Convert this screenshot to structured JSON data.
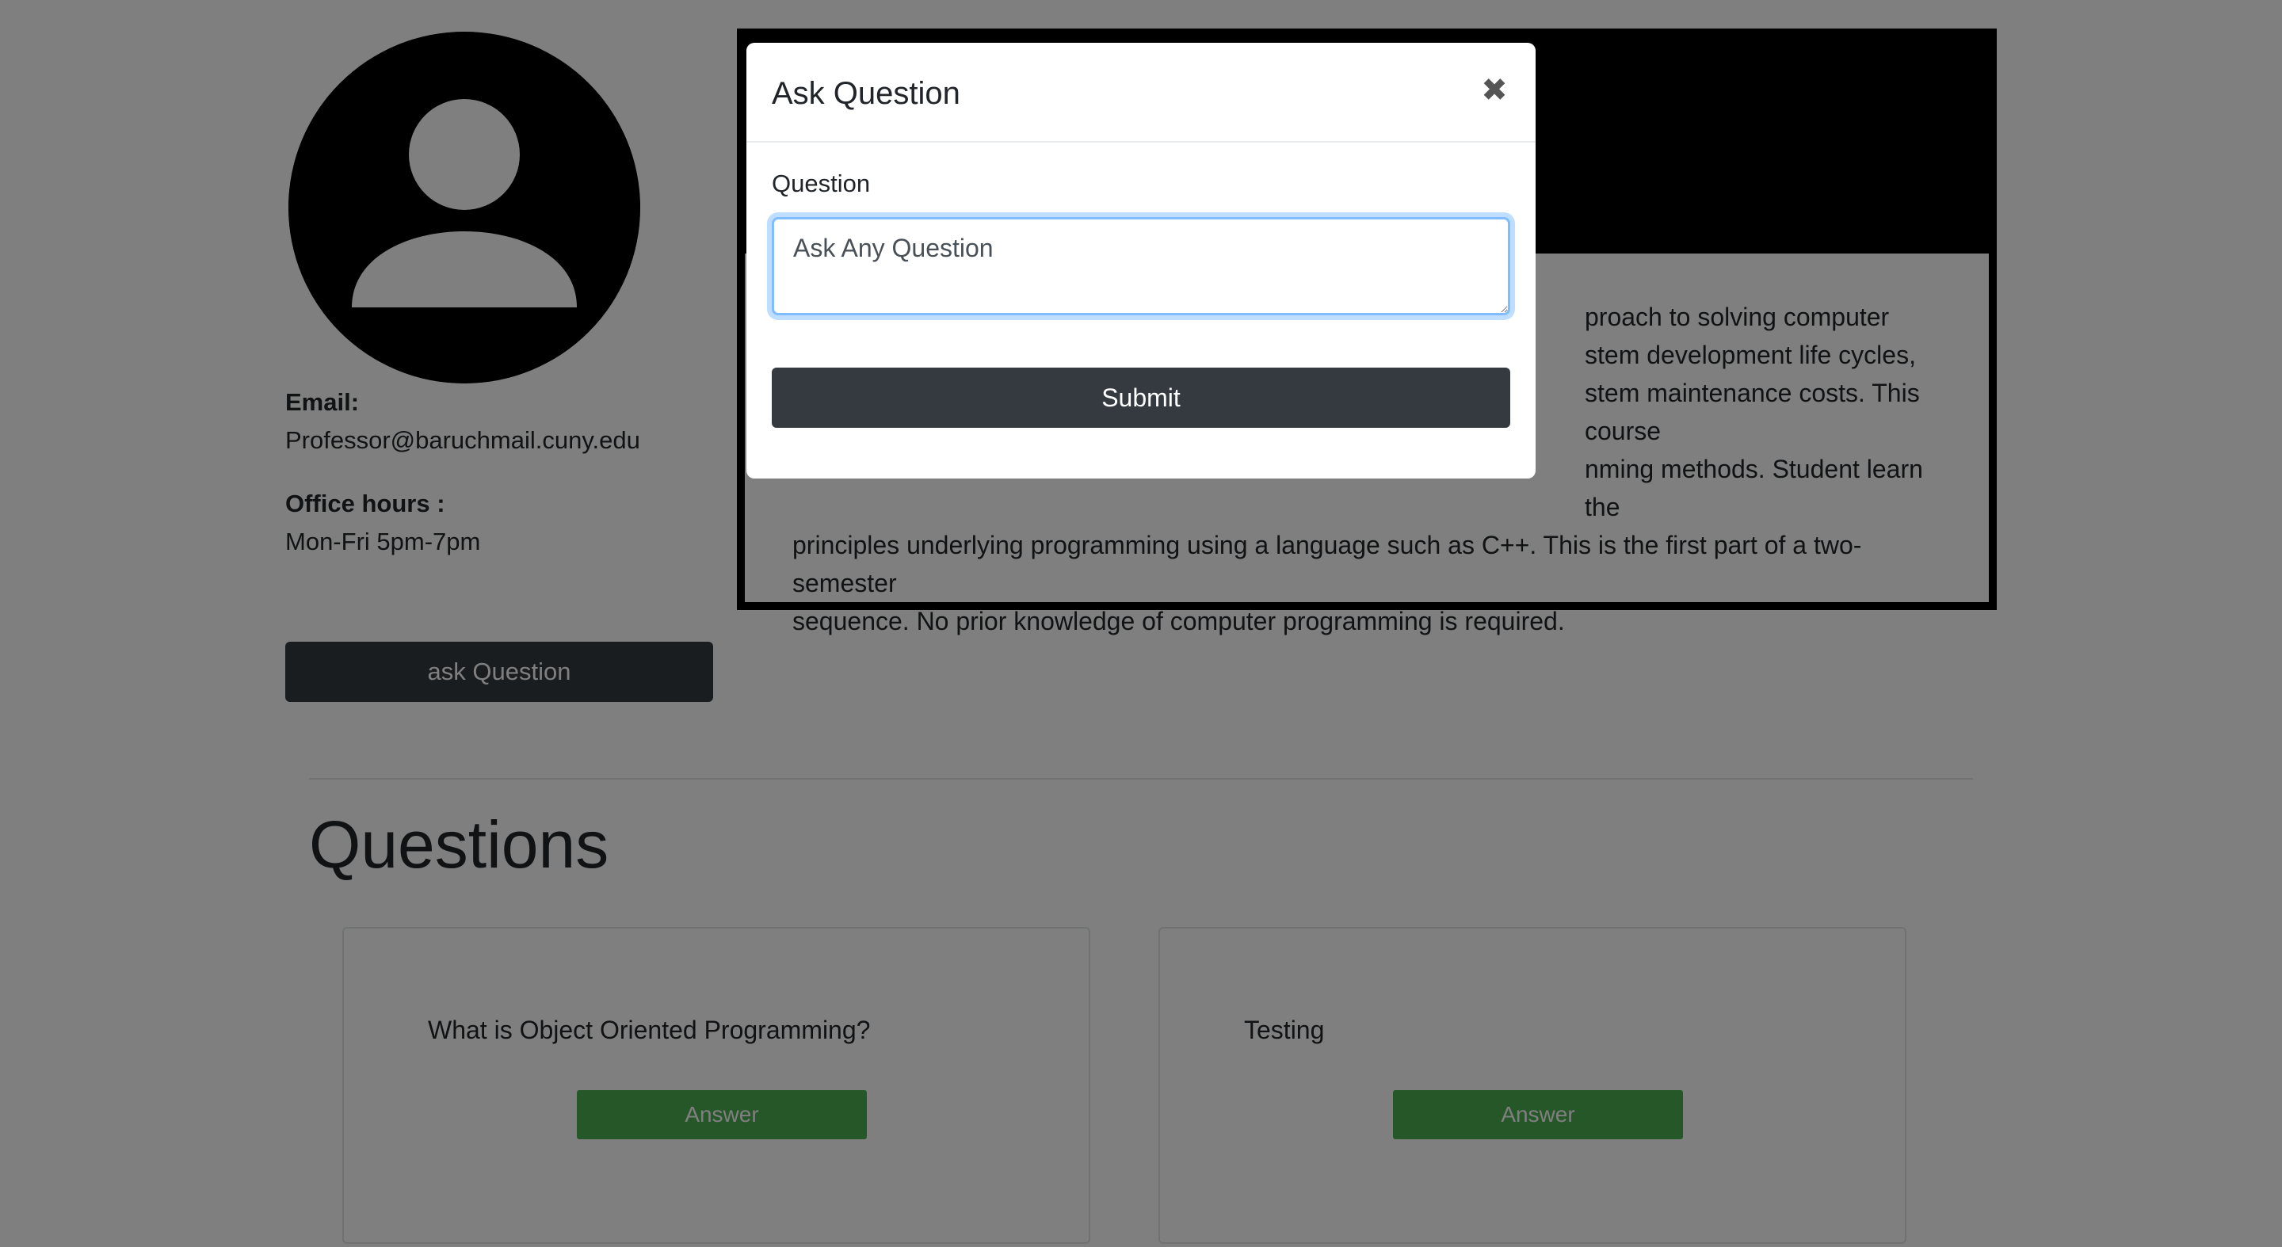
{
  "profile": {
    "avatar_icon": "person-silhouette-icon",
    "email_label": "Email:",
    "email_value": "Professor@baruchmail.cuny.edu",
    "office_hours_label": "Office hours :",
    "office_hours_value": "Mon-Fri 5pm-7pm",
    "ask_button_label": "ask Question"
  },
  "course": {
    "description_lines": [
      "proach to solving computer",
      "stem development life cycles,",
      "stem maintenance costs. This course",
      "nming methods. Student learn the",
      "principles underlying programming using a language such as C++. This is the first part of a two-semester",
      "sequence. No prior knowledge of computer programming is required."
    ]
  },
  "questions_section": {
    "heading": "Questions",
    "cards": [
      {
        "text": "What is Object Oriented Programming?",
        "answer_label": "Answer"
      },
      {
        "text": "Testing",
        "answer_label": "Answer"
      }
    ]
  },
  "modal": {
    "title": "Ask Question",
    "close_icon": "close-icon",
    "close_glyph": "✖",
    "field_label": "Question",
    "input_placeholder": "Ask Any Question",
    "input_value": "",
    "submit_label": "Submit"
  },
  "colors": {
    "dark_button": "#343a40",
    "answer_button": "#4caf50",
    "input_focus_border": "#80bdff",
    "backdrop": "rgba(0,0,0,0.5)"
  }
}
